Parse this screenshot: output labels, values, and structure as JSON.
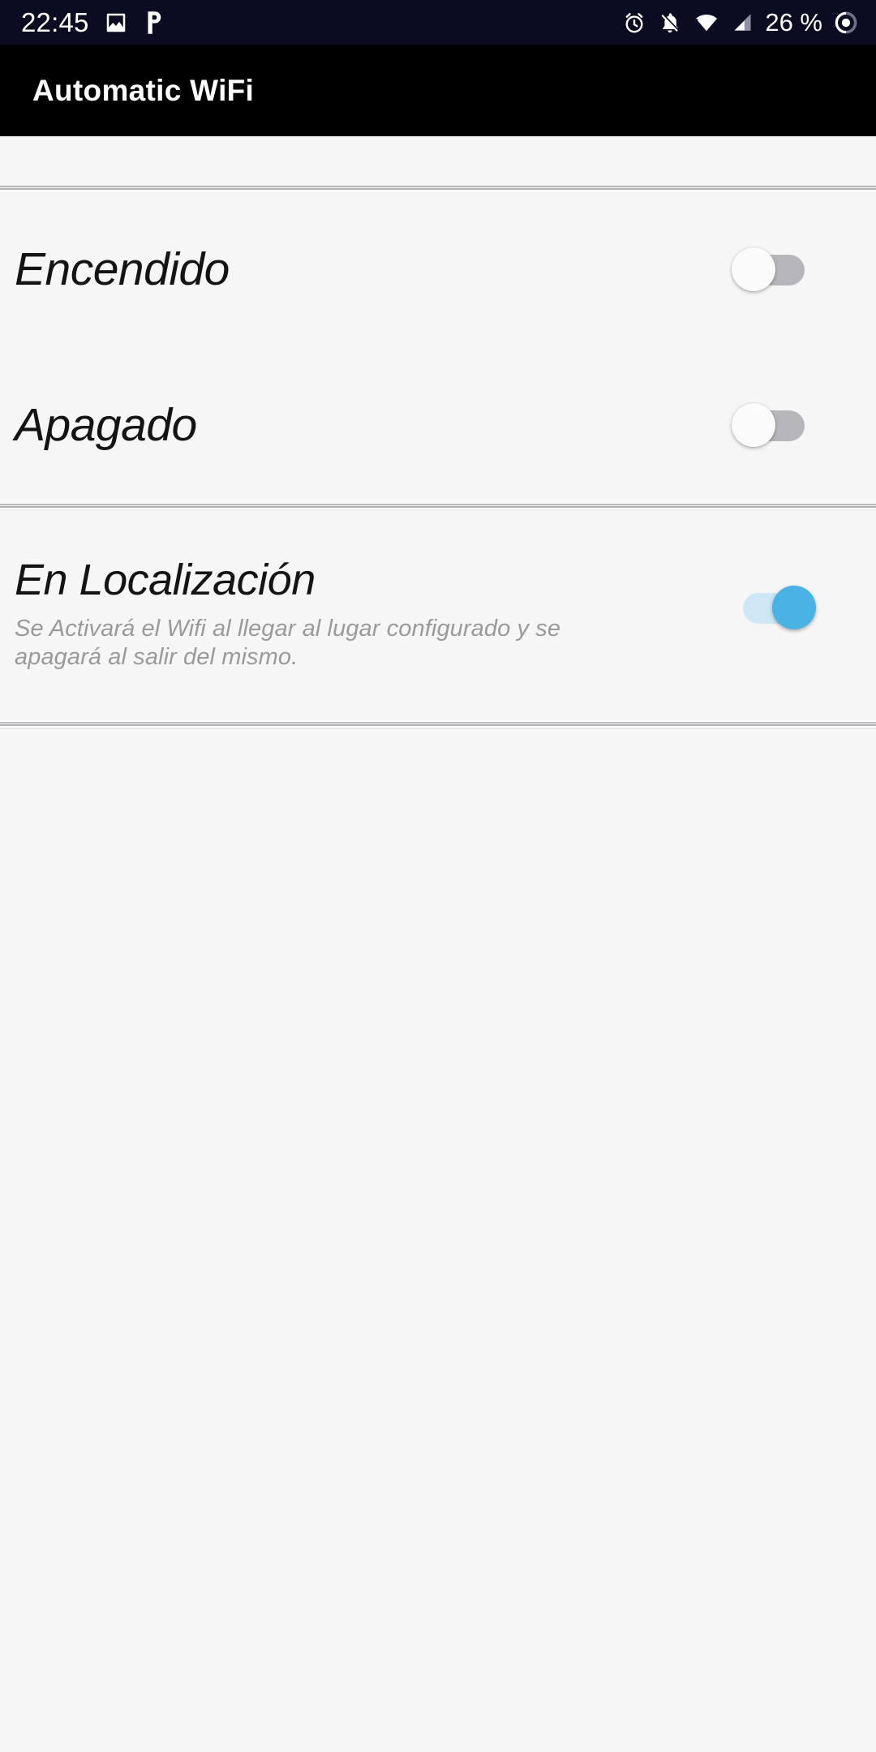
{
  "status_bar": {
    "time": "22:45",
    "battery_percent": "26 %",
    "left_icons": [
      "image-icon",
      "p-app-icon"
    ],
    "right_icons": [
      "alarm-icon",
      "notifications-muted-icon",
      "wifi-icon",
      "cellular-signal-icon",
      "battery-icon"
    ],
    "background_color": "#0b0c22",
    "foreground_color": "#ffffff"
  },
  "app_bar": {
    "title": "Automatic WiFi",
    "background_color": "#000000",
    "title_color": "#ffffff"
  },
  "settings": {
    "section_one": {
      "rows": [
        {
          "title": "Encendido",
          "toggle_state": "off",
          "toggle_label": "Encendido switch"
        },
        {
          "title": "Apagado",
          "toggle_state": "off",
          "toggle_label": "Apagado switch"
        }
      ]
    },
    "section_two": {
      "rows": [
        {
          "title": "En Localización",
          "subtitle": "Se Activará el Wifi al llegar al lugar configurado y se apagará al salir del mismo.",
          "toggle_state": "on",
          "toggle_label": "En Localización switch"
        }
      ]
    }
  },
  "colors": {
    "page_background": "#f6f6f7",
    "title_text": "#141414",
    "subtitle_text": "#9a9a9d",
    "toggle_on_thumb": "#4bb3e3",
    "toggle_on_track": "#cfe7f4",
    "toggle_off_thumb": "#fbfbfb",
    "toggle_off_track": "#b7b7bb",
    "divider": "#b9b9bd"
  }
}
